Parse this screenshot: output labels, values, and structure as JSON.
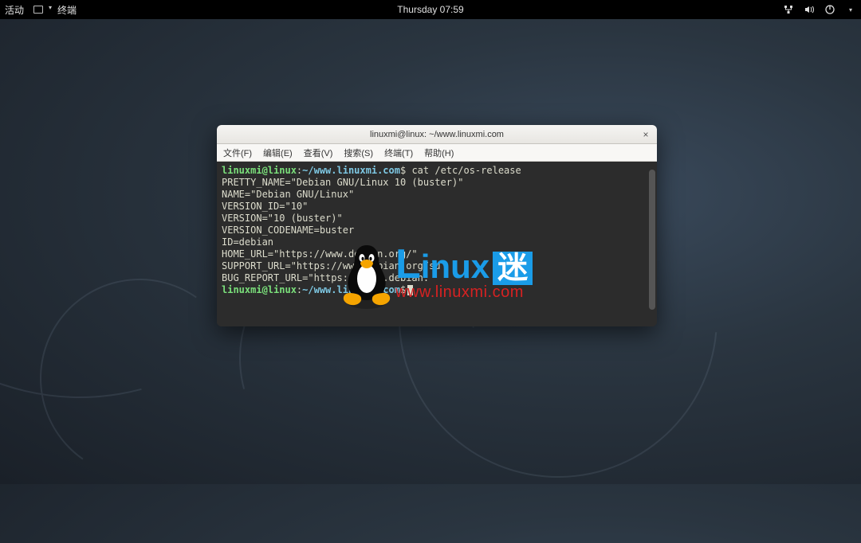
{
  "topbar": {
    "activities": "活动",
    "app": "终端",
    "datetime": "Thursday 07:59"
  },
  "window": {
    "title": "linuxmi@linux: ~/www.linuxmi.com",
    "close": "×"
  },
  "menu": {
    "file": "文件(F)",
    "edit": "编辑(E)",
    "view": "查看(V)",
    "search": "搜索(S)",
    "terminal": "终端(T)",
    "help": "帮助(H)"
  },
  "prompt": {
    "user": "linuxmi@linux",
    "path": "~/www.linuxmi.com",
    "sep": ":",
    "sym": "$"
  },
  "command": "cat /etc/os-release",
  "output": {
    "l1": "PRETTY_NAME=\"Debian GNU/Linux 10 (buster)\"",
    "l2": "NAME=\"Debian GNU/Linux\"",
    "l3": "VERSION_ID=\"10\"",
    "l4": "VERSION=\"10 (buster)\"",
    "l5": "VERSION_CODENAME=buster",
    "l6": "ID=debian",
    "l7": "HOME_URL=\"https://www.debian.org/\"",
    "l8": "SUPPORT_URL=\"https://www.debian.org/su",
    "l9": "BUG_REPORT_URL=\"https://bugs.debian."
  },
  "watermark": {
    "l": "L",
    "inux": "inux",
    "mi": "迷",
    "url": "www.linuxmi.com"
  }
}
